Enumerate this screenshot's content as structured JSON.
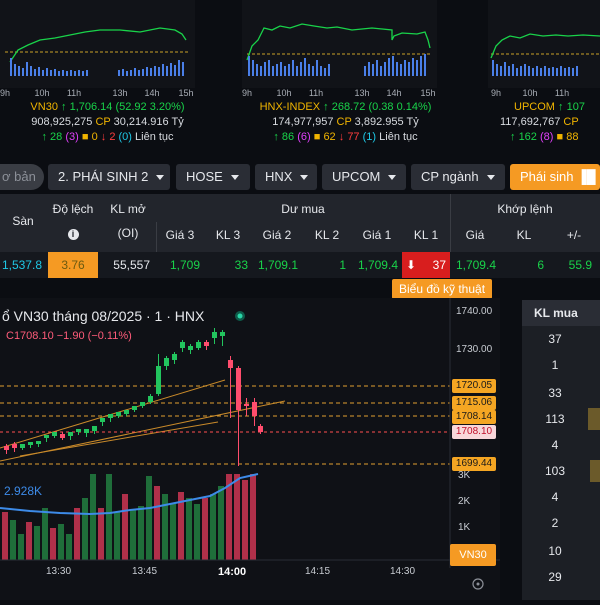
{
  "mini_charts": {
    "vn30": {
      "ticks": [
        "9h",
        "10h",
        "11h",
        "13h",
        "14h",
        "15h"
      ]
    },
    "hnx": {
      "ticks": [
        "9h",
        "10h",
        "11h",
        "13h",
        "14h",
        "15h"
      ]
    },
    "upcom": {
      "ticks": [
        "9h",
        "10h",
        "11h"
      ]
    }
  },
  "indices": [
    {
      "name": "VN30",
      "value": "1,706.14",
      "change": "(52.92 3.20%)",
      "volume": "908,925,275",
      "cp_label": "CP",
      "cp_value": "30,214.916",
      "unit": "Tỷ",
      "up": "28",
      "up_ceiling": "(3)",
      "flat": "0",
      "down": "2",
      "down_floor": "(0)",
      "lien_tuc": "Liên tục"
    },
    {
      "name": "HNX-INDEX",
      "value": "268.72",
      "change": "(0.38 0.14%)",
      "volume": "174,977,957",
      "cp_label": "CP",
      "cp_value": "3,892.955",
      "unit": "Tỷ",
      "up": "86",
      "up_ceiling": "(6)",
      "flat": "62",
      "down": "77",
      "down_floor": "(1)",
      "lien_tuc": "Liên tục"
    },
    {
      "name": "UPCOM",
      "value": "107",
      "change": "",
      "volume": "117,692,767",
      "cp_label": "CP",
      "cp_value": "",
      "unit": "",
      "up": "162",
      "up_ceiling": "(8)",
      "flat": "88",
      "down": "",
      "down_floor": "",
      "lien_tuc": ""
    }
  ],
  "tabs": {
    "pill": "ơ bản",
    "items": [
      "2. PHÁI SINH 2",
      "HOSE",
      "HNX",
      "UPCOM",
      "CP ngành"
    ],
    "active": "Phái sinh"
  },
  "table": {
    "headers": {
      "san": "Sàn",
      "do_lech": "Độ lệch",
      "kl_mo": "KL mở",
      "kl_mo_sub": "(OI)",
      "du_mua": "Dư mua",
      "khop_lenh": "Khớp lệnh",
      "gia3": "Giá 3",
      "kl3": "KL 3",
      "gia2": "Giá 2",
      "kl2": "KL 2",
      "gia1": "Giá 1",
      "kl1": "KL 1",
      "gia": "Giá",
      "kl": "KL",
      "pm": "+/-"
    },
    "row": {
      "san": "1,537.8",
      "do_lech": "3.76",
      "kl_mo": "55,557",
      "gia3": "1,709",
      "kl3": "33",
      "gia2": "1,709.1",
      "kl2": "1",
      "gia1": "1,709.4",
      "kl1": "37",
      "gia": "1,709.4",
      "kl": "6",
      "pm": "55.9"
    }
  },
  "chart": {
    "button": "Biểu đồ kỹ thuật",
    "title": "ổ VN30 tháng 08/2025 · 1 · HNX",
    "ohlc": "C1708.10 −1.90 (−0.11%)",
    "volume_label": "2.928K",
    "symbol_badge": "VN30",
    "price_axis": [
      "1740.00",
      "1730.00"
    ],
    "price_boxes": [
      "1720.05",
      "1715.06",
      "1708.14",
      "1708.10",
      "1699.44"
    ],
    "volume_axis": [
      "3K",
      "2K",
      "1K"
    ],
    "time_axis": [
      "13:30",
      "13:45",
      "14:00",
      "14:15",
      "14:30"
    ]
  },
  "kl_mua": {
    "header": "KL mua",
    "values": [
      "37",
      "1",
      "33",
      "113",
      "4",
      "103",
      "4",
      "2",
      "10",
      "29"
    ]
  }
}
